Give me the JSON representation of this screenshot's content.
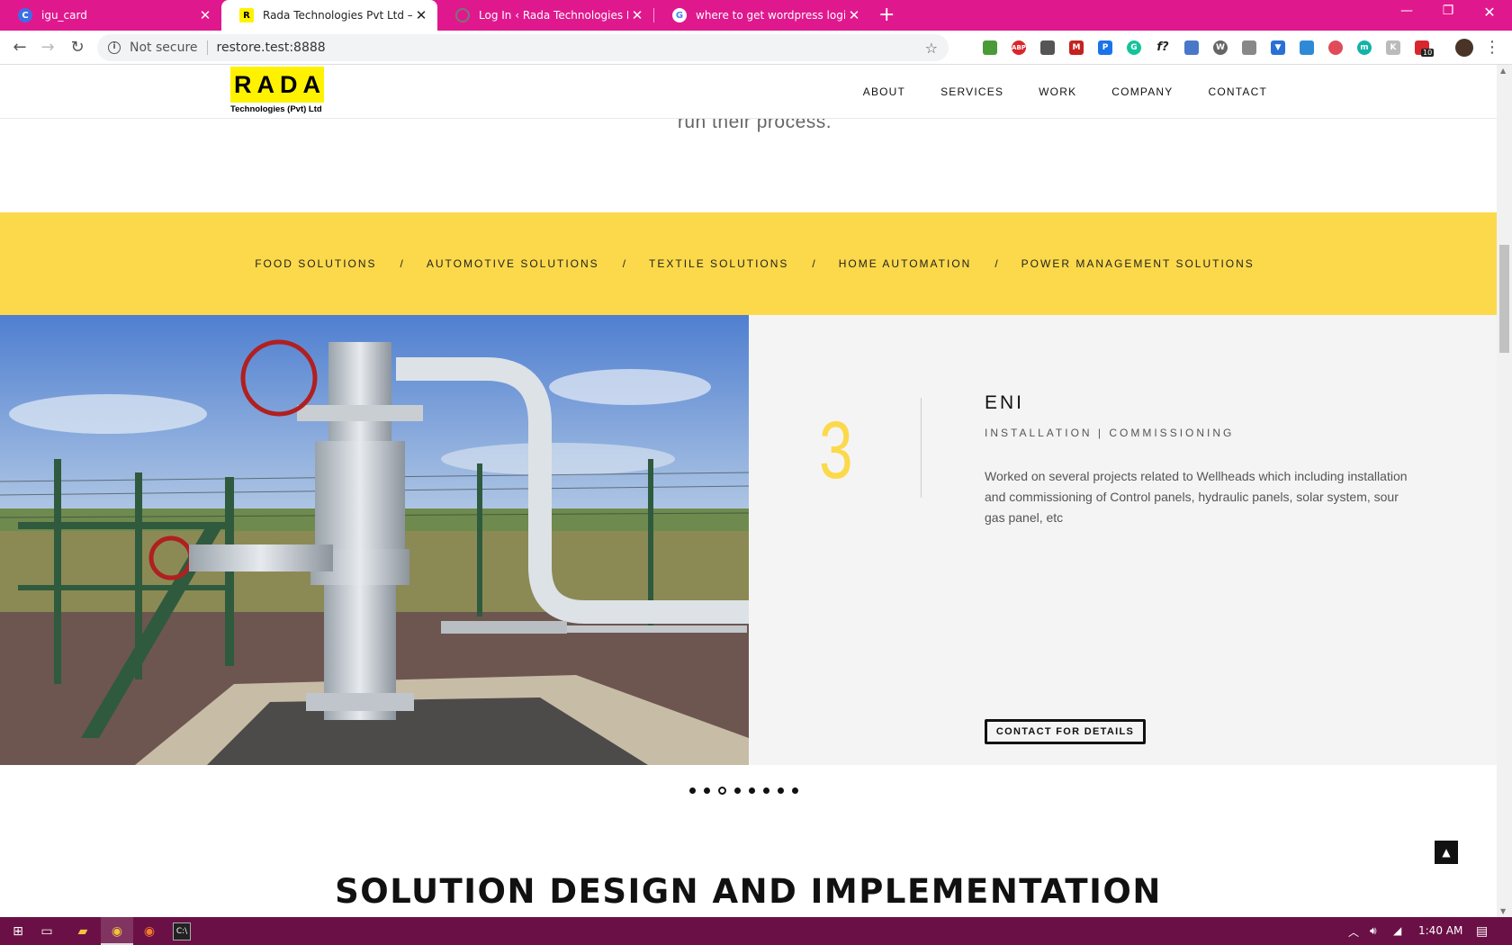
{
  "browser": {
    "tabs": [
      {
        "title": "igu_card",
        "favicon": "c-icon",
        "favicon_color": "#3b6fe8",
        "active": false
      },
      {
        "title": "Rada Technologies Pvt Ltd – Auto",
        "favicon": "r-icon",
        "favicon_color": "#fff200",
        "active": true
      },
      {
        "title": "Log In ‹ Rada Technologies Pvt Lt",
        "favicon": "wordpress-icon",
        "favicon_color": "#666666",
        "active": false
      },
      {
        "title": "where to get wordpress login pa",
        "favicon": "google-icon",
        "favicon_color": "#ffffff",
        "active": false
      }
    ],
    "security_label": "Not secure",
    "url": "restore.test:8888",
    "extension_badge": "10"
  },
  "site": {
    "logo_text": "RADA",
    "logo_sub": "Technologies (Pvt) Ltd",
    "nav": [
      "ABOUT",
      "SERVICES",
      "WORK",
      "COMPANY",
      "CONTACT"
    ],
    "intro_tail": "run their process.",
    "categories": [
      "FOOD SOLUTIONS",
      "AUTOMOTIVE SOLUTIONS",
      "TEXTILE SOLUTIONS",
      "HOME AUTOMATION",
      "POWER MANAGEMENT SOLUTIONS"
    ],
    "category_separator": "/",
    "slide": {
      "number": "3",
      "title": "ENI",
      "subtitle": "INSTALLATION | COMMISSIONING",
      "description": "Worked on several projects related to Wellheads which including installation and commissioning of Control panels, hydraulic panels, solar system, sour gas panel, etc",
      "cta": "CONTACT FOR DETAILS",
      "dot_count": 8,
      "active_dot": 3
    },
    "section_title": "SOLUTION DESIGN AND IMPLEMENTATION",
    "accent_color": "#fcd94b"
  },
  "taskbar": {
    "clock": "1:40 AM"
  }
}
